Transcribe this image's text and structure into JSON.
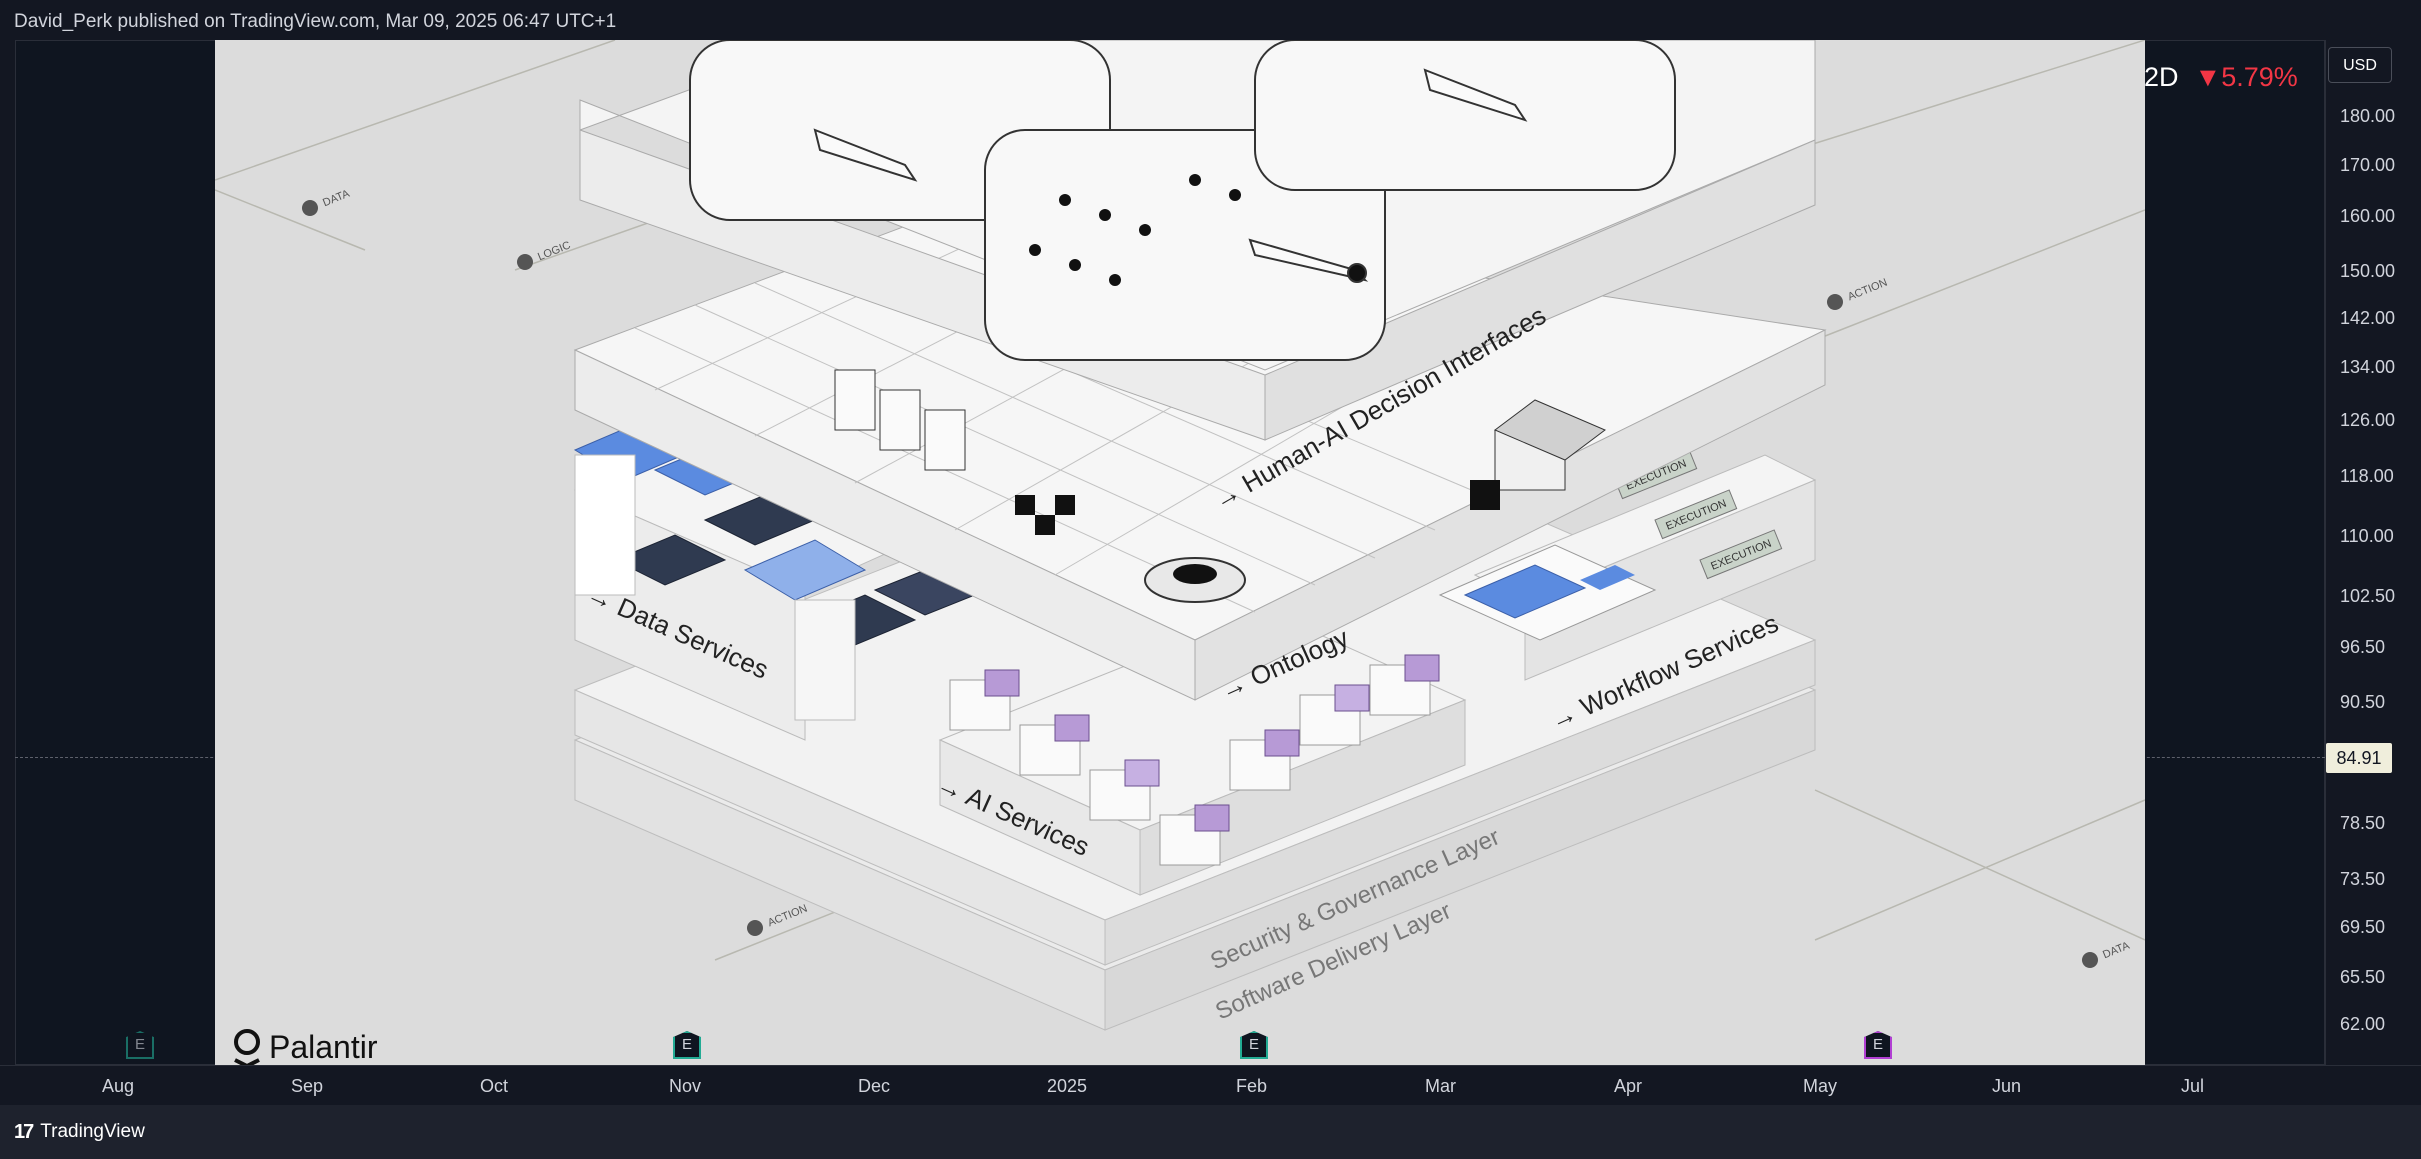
{
  "header": {
    "publish_line": "David_Perk published on TradingView.com, Mar 09, 2025 06:47 UTC+1"
  },
  "chart_data": {
    "type": "line",
    "title": "",
    "currency": "USD",
    "last_price": "84.91",
    "change_prefix": "2D",
    "change_pct": "▼5.79%",
    "y_ticks": [
      "180.00",
      "170.00",
      "160.00",
      "150.00",
      "142.00",
      "134.00",
      "126.00",
      "118.00",
      "110.00",
      "102.50",
      "96.50",
      "90.50",
      "78.50",
      "73.50",
      "69.50",
      "65.50",
      "62.00"
    ],
    "y_scale": "log",
    "x_ticks": [
      "Aug",
      "Sep",
      "Oct",
      "Nov",
      "Dec",
      "2025",
      "Feb",
      "Mar",
      "Apr",
      "May",
      "Jun",
      "Jul"
    ],
    "earnings_markers": [
      {
        "label": "E",
        "month": "Aug",
        "state": "past"
      },
      {
        "label": "E",
        "month": "Nov",
        "state": "past"
      },
      {
        "label": "E",
        "month": "Feb",
        "state": "past"
      },
      {
        "label": "E",
        "month": "May",
        "state": "upcoming"
      }
    ],
    "colors": {
      "background": "#0f1520",
      "down": "#f23645",
      "earnings_past": "#22ab94",
      "earnings_upcoming": "#b13fd3",
      "price_tag": "#f0eedc"
    }
  },
  "overlay_image": {
    "brand": "Palantir",
    "layers": {
      "interfaces": "→ Human-AI Decision Interfaces",
      "ontology": "→ Ontology",
      "data": "→ Data Services",
      "workflow": "→ Workflow Services",
      "ai": "→ AI Services",
      "security": "Security & Governance Layer",
      "delivery": "Software Delivery Layer"
    },
    "tags": {
      "data": "DATA",
      "logic": "LOGIC",
      "action": "ACTION",
      "execution": "EXECUTION"
    }
  },
  "footer": {
    "brand": "TradingView",
    "brand_mark": "17"
  }
}
